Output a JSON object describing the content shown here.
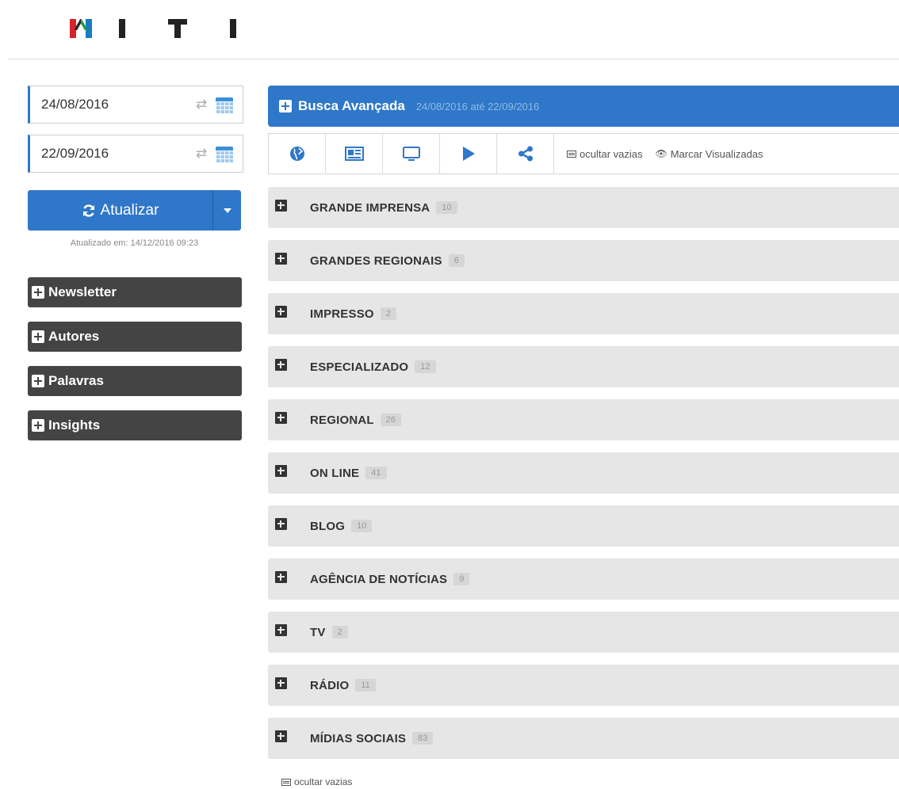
{
  "logo": {
    "letters": [
      "M",
      "I",
      "T",
      "I"
    ]
  },
  "sidebar": {
    "start_date": "24/08/2016",
    "end_date": "22/09/2016",
    "refresh_label": "Atualizar",
    "updated_text": "Atualizado em: 14/12/2016 09:23",
    "panels": [
      {
        "label": "Newsletter"
      },
      {
        "label": "Autores"
      },
      {
        "label": "Palavras"
      },
      {
        "label": "Insights"
      }
    ]
  },
  "search": {
    "title": "Busca Avançada",
    "range": "24/08/2016 até 22/09/2016"
  },
  "toolbar": {
    "icons": [
      "globe-icon",
      "newspaper-icon",
      "monitor-icon",
      "play-icon",
      "share-icon"
    ],
    "hide_empty": "ocultar vazias",
    "mark_viewed": "Marcar Visualizadas"
  },
  "categories": [
    {
      "label": "GRANDE IMPRENSA",
      "count": "10"
    },
    {
      "label": "GRANDES REGIONAIS",
      "count": "6"
    },
    {
      "label": "IMPRESSO",
      "count": "2"
    },
    {
      "label": "ESPECIALIZADO",
      "count": "12"
    },
    {
      "label": "REGIONAL",
      "count": "26"
    },
    {
      "label": "ON LINE",
      "count": "41"
    },
    {
      "label": "BLOG",
      "count": "10"
    },
    {
      "label": "AGÊNCIA DE NOTÍCIAS",
      "count": "9"
    },
    {
      "label": "TV",
      "count": "2"
    },
    {
      "label": "RÁDIO",
      "count": "11"
    },
    {
      "label": "MÍDIAS SOCIAIS",
      "count": "83"
    }
  ],
  "footer": {
    "hide_empty": "ocultar vazias"
  },
  "colors": {
    "accent": "#2f77c8",
    "panel": "#444444",
    "row": "#e6e6e6"
  }
}
